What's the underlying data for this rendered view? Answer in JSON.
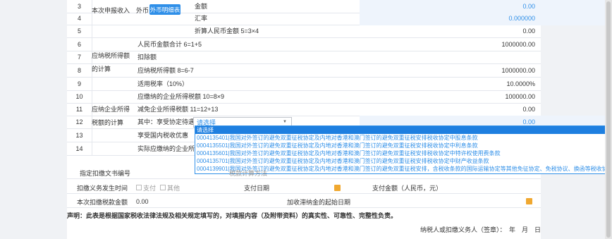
{
  "rows": [
    {
      "num": "3",
      "group": "本次申报收入",
      "sub": "外币",
      "label": "金额",
      "value": "0.00",
      "value_blue": true
    },
    {
      "num": "4",
      "label": "汇率",
      "value": "0.000000",
      "value_blue": true
    },
    {
      "num": "5",
      "label": "折算人民币金额 5=3×4",
      "value": "0.00"
    },
    {
      "num": "6",
      "label": "人民币金额合计 6=1+5",
      "value": "1000000.00"
    },
    {
      "num": "7",
      "group": "应纳税所得额",
      "label": "扣除额",
      "value": ""
    },
    {
      "num": "8",
      "group": "的计算",
      "label": "应纳税所得额 8=6-7",
      "value": "1000000.00"
    },
    {
      "num": "9",
      "label": "适用税率（10%）",
      "value": "10.0000%"
    },
    {
      "num": "10",
      "label": "应缴纳的企业所得税额 10=8×9",
      "value": "100000.00"
    },
    {
      "num": "11",
      "group": "应纳企业所得",
      "label": "减免企业所得税额 11=12+13",
      "value": "0.00"
    },
    {
      "num": "12",
      "group": "税额的计算",
      "label": "其中：享受协定待遇",
      "value": "0.00",
      "value_blue": true
    },
    {
      "num": "13",
      "label": "享受国内税收优惠",
      "value": ""
    },
    {
      "num": "14",
      "label": "实际应缴纳的企业所得税",
      "value": ""
    }
  ],
  "detail_button": "外币明细表",
  "select": {
    "value": "请选择"
  },
  "dropdown_options": [
    "请选择",
    "0004135401|我国对外签订的避免双重征税协定及内地对香港和澳门签订的避免双重征税安排税收协定中股息条款",
    "0004135501|我国对外签订的避免双重征税协定及内地对香港和澳门签订的避免双重征税安排税收协定中利息条款",
    "0004135601|我国对外签订的避免双重征税协定及内地对香港和澳门签订的避免双重征税安排税收协定中特许权使用费条款",
    "0004135701|我国对外签订的避免双重征税协定及内地对香港和澳门签订的避免双重征税安排税收协定中财产收益条款",
    "0004139901|我国对外签订的避免双重征税协定及内地对香港和澳门签订的避免双重征税安排，含税收条款的国际运输协定等其他免征协定、免税协议、换函等税收协"
  ],
  "lower": {
    "doc_label": "指定扣缴文书编号",
    "calc_label": "税款计算方法",
    "time_label": "扣缴义务发生时间",
    "opt_pay": "支付",
    "opt_other": "其他",
    "pay_date_label": "支付日期",
    "pay_amount_label": "支付金额（人民币，元）",
    "withheld_label": "本次扣缴税款金额",
    "withheld_value": "0.00",
    "late_fee_label": "加收滞纳金的起始日期"
  },
  "declaration": "声明：此表是根据国家税收法律法规及相关规定填写的，对填报内容（及附带资料）的真实性、可靠性、完整性负责。",
  "signature": "纳税人或扣缴义务人（签章）：　年　月　日"
}
